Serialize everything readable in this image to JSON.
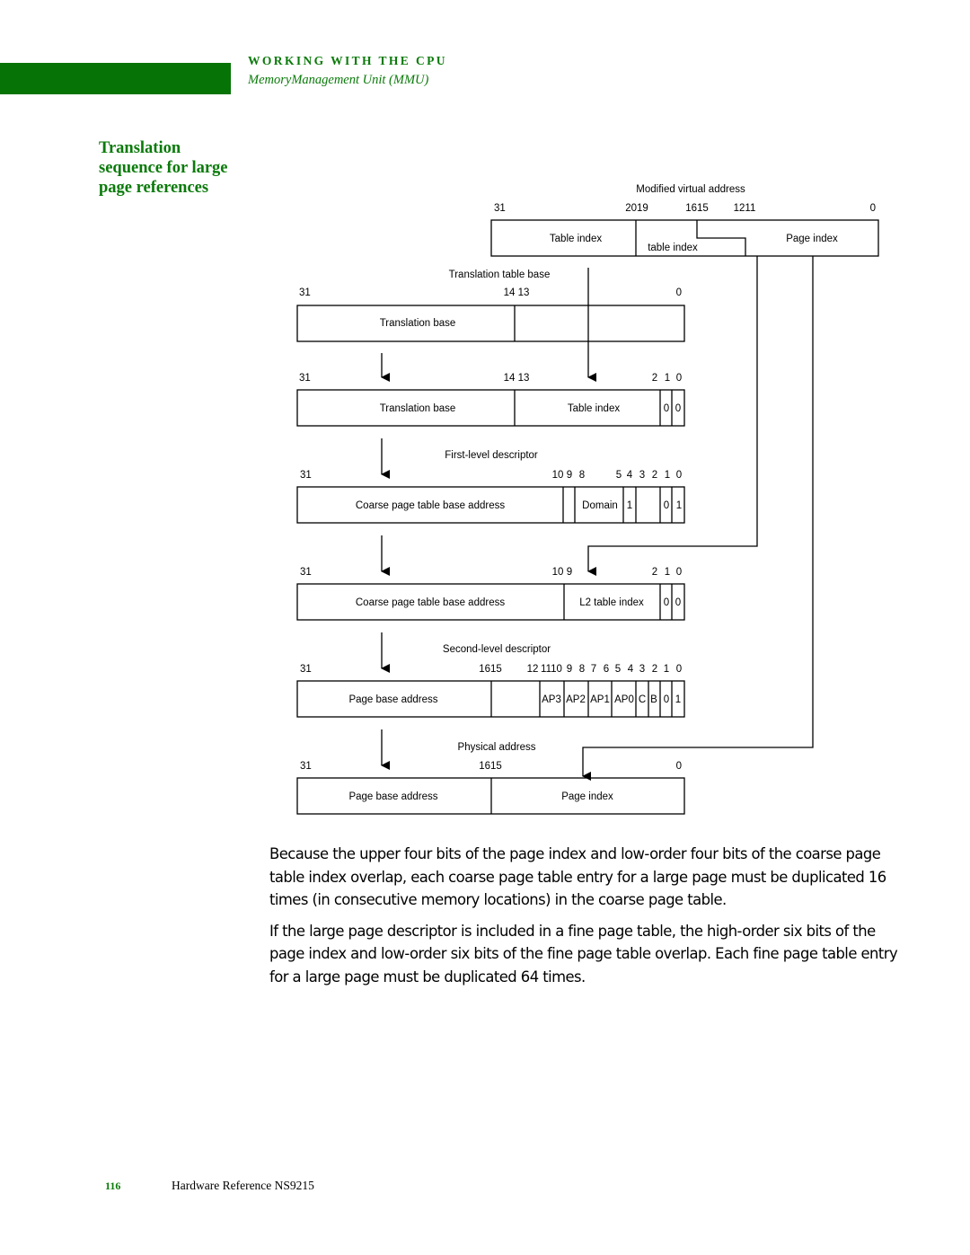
{
  "header": {
    "chapter": "WORKING WITH THE CPU",
    "section": "MemoryManagement Unit (MMU)",
    "accent_color": "#067306"
  },
  "heading": {
    "lines": [
      "Translation",
      "sequence for large",
      "page references"
    ]
  },
  "diagram": {
    "mva": {
      "title": "Modified virtual address",
      "bits": [
        "31",
        "2019",
        "1615",
        "1211",
        "0"
      ],
      "fields": [
        "Table index",
        "table index",
        "Page  index"
      ]
    },
    "ttb": {
      "title": "Translation table base",
      "bits": [
        "31",
        "14 13",
        "0"
      ],
      "fields": [
        "Translation base"
      ]
    },
    "tb_index": {
      "bits": [
        "31",
        "14 13",
        "2",
        "1",
        "0"
      ],
      "fields": [
        "Translation base",
        "Table index",
        "0",
        "0"
      ]
    },
    "fld": {
      "title": "First-level descriptor",
      "bits": [
        "31",
        "10",
        "9",
        "8",
        "5",
        "4",
        "3",
        "2",
        "1",
        "0"
      ],
      "fields": [
        "Coarse page table base address",
        "Domain",
        "1",
        "0",
        "1"
      ]
    },
    "l2addr": {
      "bits": [
        "31",
        "10",
        "9",
        "2",
        "1",
        "0"
      ],
      "fields": [
        "Coarse page table base address",
        "L2 table index",
        "0",
        "0"
      ]
    },
    "sld": {
      "title": "Second-level descriptor",
      "bits": [
        "31",
        "1615",
        "12",
        "1110",
        "9",
        "8",
        "7",
        "6",
        "5",
        "4",
        "3",
        "2",
        "1",
        "0"
      ],
      "fields": [
        "Page base address",
        "AP3",
        "AP2",
        "AP1",
        "AP0",
        "C",
        "B",
        "0",
        "1"
      ]
    },
    "pa": {
      "title": "Physical address",
      "bits": [
        "31",
        "1615",
        "0"
      ],
      "fields": [
        "Page base address",
        "Page index"
      ]
    }
  },
  "body": {
    "paragraphs": [
      "Because the upper four bits of the page index and low-order four bits of the coarse page table index overlap, each coarse page table entry for a large page must be duplicated 16 times (in consecutive memory locations) in the coarse page table.",
      "If the large page descriptor is included in a fine page table, the high-order six bits of the page index and low-order six bits of the fine page table overlap. Each fine page table entry for a large page must be duplicated 64 times."
    ]
  },
  "footer": {
    "page_number": "116",
    "document_title": "Hardware Reference NS9215"
  }
}
